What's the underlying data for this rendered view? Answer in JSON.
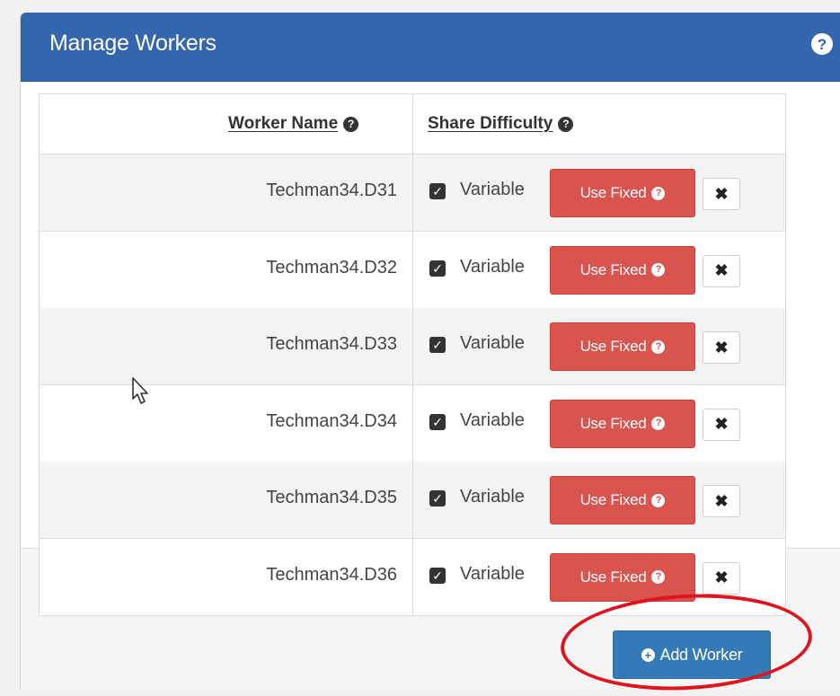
{
  "panel": {
    "title": "Manage Workers",
    "help_icon": "question-circle-icon"
  },
  "table": {
    "headers": {
      "worker_name": "Worker Name",
      "share_difficulty": "Share Difficulty"
    },
    "rows": [
      {
        "name": "Techman34.D31",
        "variable_checked": true,
        "variable_label": "Variable",
        "fixed_label": "Use Fixed"
      },
      {
        "name": "Techman34.D32",
        "variable_checked": true,
        "variable_label": "Variable",
        "fixed_label": "Use Fixed"
      },
      {
        "name": "Techman34.D33",
        "variable_checked": true,
        "variable_label": "Variable",
        "fixed_label": "Use Fixed"
      },
      {
        "name": "Techman34.D34",
        "variable_checked": true,
        "variable_label": "Variable",
        "fixed_label": "Use Fixed"
      },
      {
        "name": "Techman34.D35",
        "variable_checked": true,
        "variable_label": "Variable",
        "fixed_label": "Use Fixed"
      },
      {
        "name": "Techman34.D36",
        "variable_checked": true,
        "variable_label": "Variable",
        "fixed_label": "Use Fixed"
      }
    ]
  },
  "footer": {
    "add_worker_label": "Add Worker"
  },
  "colors": {
    "header_blue": "#3466b0",
    "danger_red": "#d9534f",
    "primary_blue": "#337ab7",
    "annotation_red": "#e0141e"
  }
}
